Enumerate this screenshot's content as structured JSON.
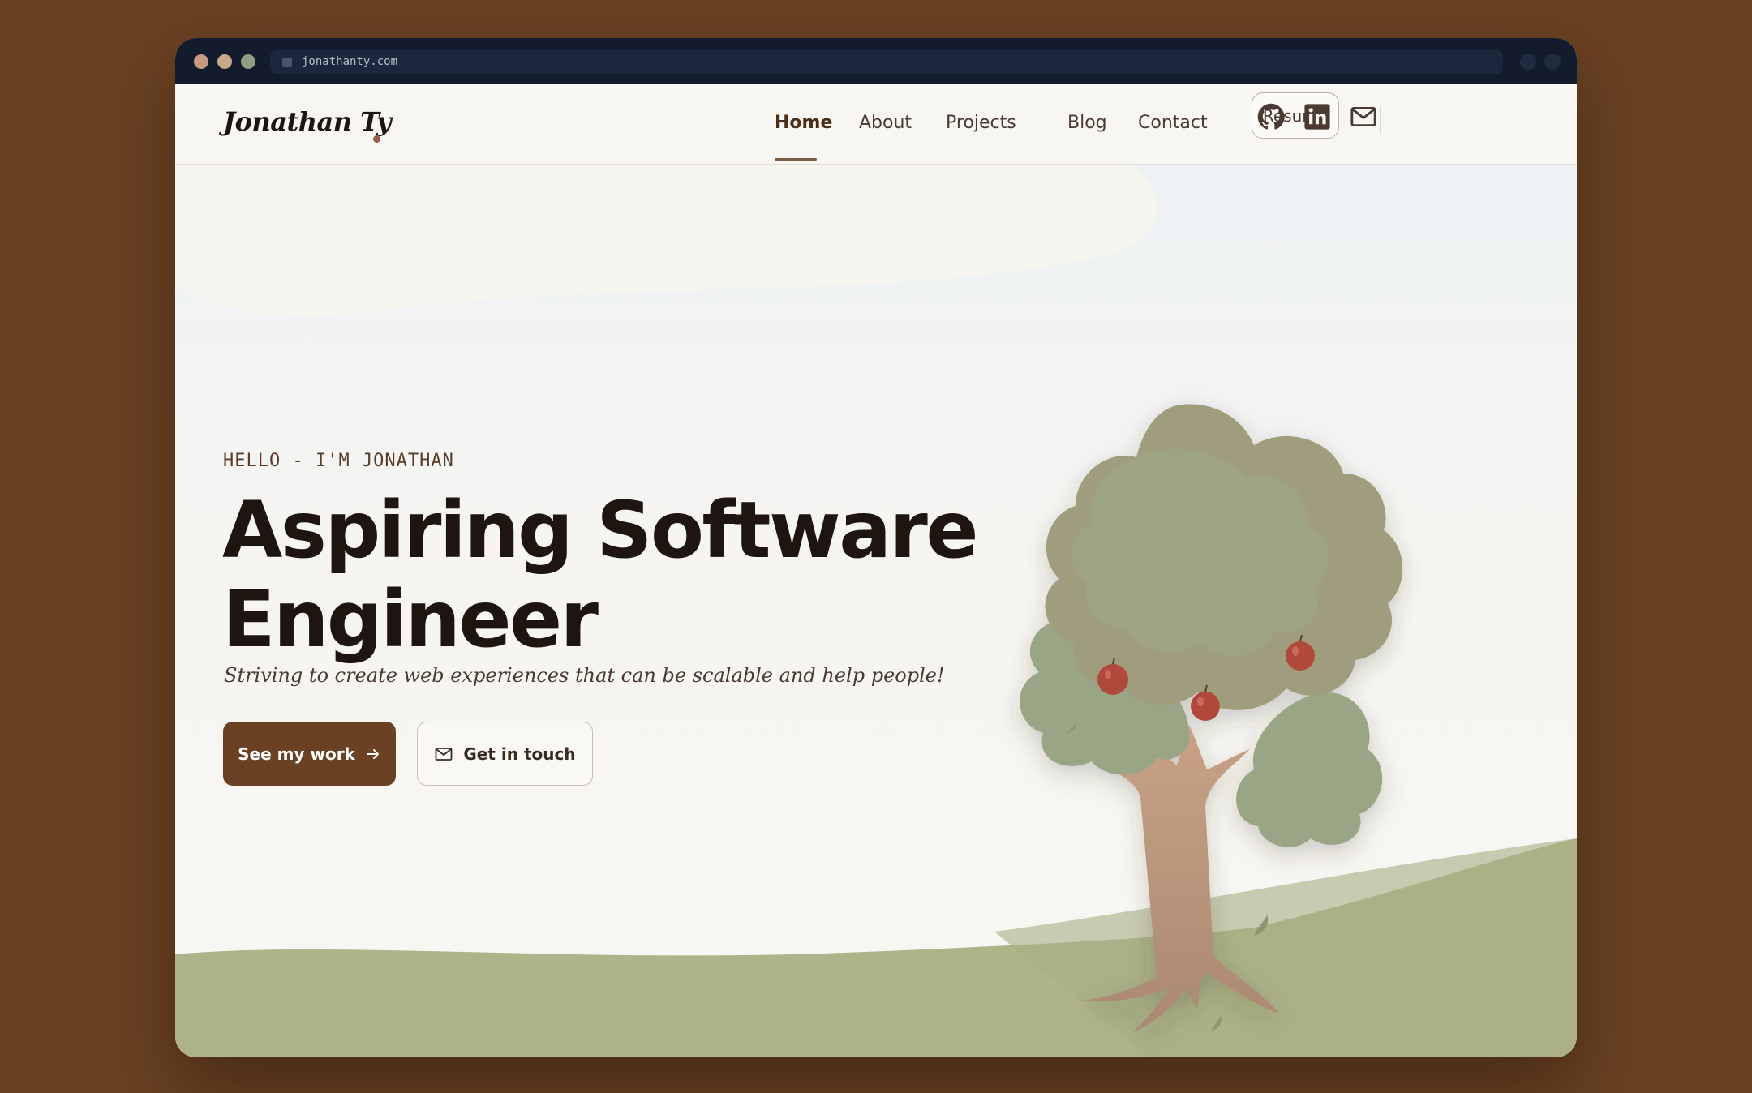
{
  "browser": {
    "url": "jonathanty.com"
  },
  "nav": {
    "logo": "Jonathan Ty",
    "links": [
      "Home",
      "About",
      "Projects",
      "Blog",
      "Contact"
    ],
    "active": "Home",
    "resume_label": "Resume",
    "social_icons": [
      "github-icon",
      "linkedin-icon",
      "mail-icon"
    ]
  },
  "hero": {
    "eyebrow": "HELLO - I'M JONATHAN",
    "headline_line1": "Aspiring Software",
    "headline_line2": "Engineer",
    "tagline": "Striving to create web experiences that can be scalable and help people!",
    "primary_cta": "See my work",
    "secondary_cta": "Get in touch"
  },
  "colors": {
    "page_bg": "#6a4223",
    "accent_brown": "#6a4223",
    "text_dark": "#1e1510",
    "grass": "#aeb38a",
    "foliage": "#9aa585",
    "apple": "#b04a3a"
  }
}
